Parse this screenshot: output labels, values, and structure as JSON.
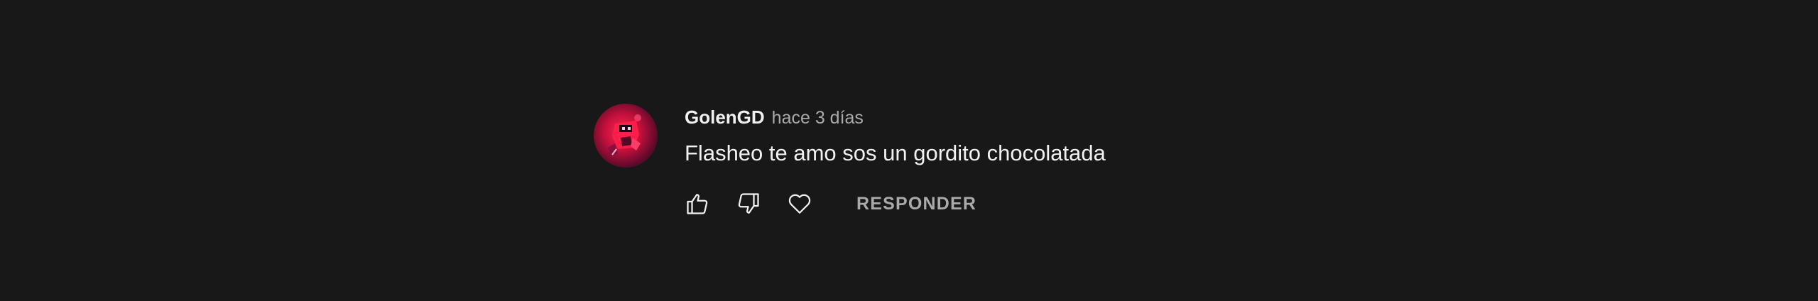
{
  "comment": {
    "author": "GolenGD",
    "timestamp": "hace 3 días",
    "text": "Flasheo te amo sos un gordito chocolatada",
    "avatar_icon": "avatar-image",
    "actions": {
      "like_icon": "thumbs-up-icon",
      "dislike_icon": "thumbs-down-icon",
      "heart_icon": "heart-icon",
      "reply_label": "RESPONDER"
    }
  },
  "colors": {
    "background": "#181818",
    "primary_text": "#f1f1f1",
    "secondary_text": "#aaaaaa"
  }
}
